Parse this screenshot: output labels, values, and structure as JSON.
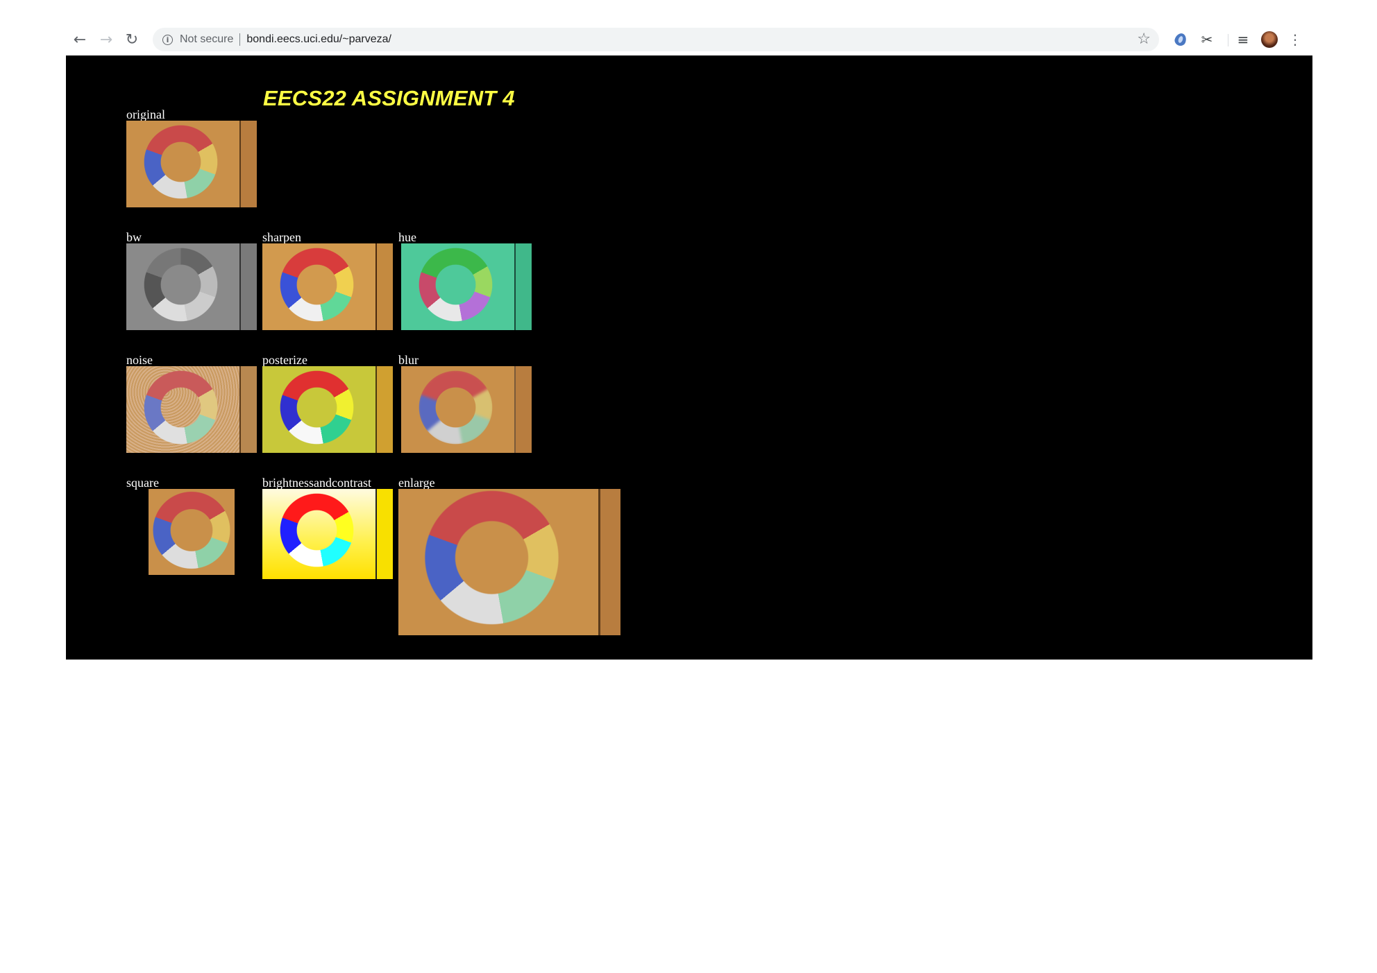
{
  "browser": {
    "security_label": "Not secure",
    "url": "bondi.eecs.uci.edu/~parveza/"
  },
  "page": {
    "title": "EECS22 ASSIGNMENT 4",
    "images": [
      {
        "caption": "original"
      },
      {
        "caption": "bw"
      },
      {
        "caption": "sharpen"
      },
      {
        "caption": "hue"
      },
      {
        "caption": "noise"
      },
      {
        "caption": "posterize"
      },
      {
        "caption": "blur"
      },
      {
        "caption": "square"
      },
      {
        "caption": "brightnessandcontrast"
      },
      {
        "caption": "enlarge"
      }
    ]
  },
  "colors": {
    "page_background": "#000000",
    "title": "#ffff44",
    "caption": "#ffffff"
  },
  "icons": [
    "back-arrow-icon",
    "forward-arrow-icon",
    "reload-icon",
    "info-icon",
    "star-icon",
    "extension-drop-icon",
    "scissors-icon",
    "media-queue-icon",
    "profile-avatar",
    "menu-dots-icon"
  ]
}
